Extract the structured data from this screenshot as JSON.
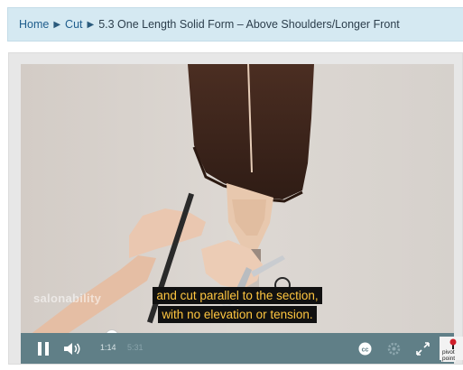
{
  "breadcrumb": {
    "home_label": "Home",
    "cut_label": "Cut",
    "current_label": "5.3 One Length Solid Form – Above Shoulders/Longer Front",
    "separator_glyph": "▶"
  },
  "video": {
    "watermark": "salonability",
    "caption_line_1": "and cut parallel to the section,",
    "caption_line_2": "with no elevation or tension.",
    "progress_fraction": 0.21
  },
  "controls": {
    "time_current": "1:14",
    "time_total": "5:31",
    "brand": "pivot point",
    "icons": [
      "pause-icon",
      "volume-icon",
      "closed-captions-icon",
      "settings-icon",
      "fullscreen-icon"
    ]
  },
  "colors": {
    "breadcrumb_bg": "#d5e9f2",
    "link": "#1f5d8c",
    "caption_text": "#ffc640",
    "control_bar": "#607f87"
  }
}
